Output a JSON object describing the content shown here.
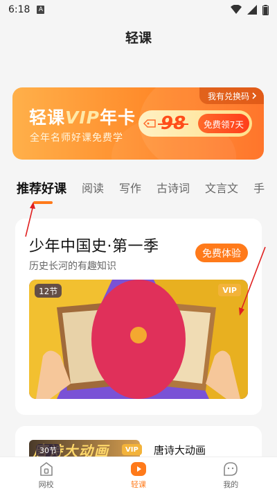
{
  "status_bar": {
    "time": "6:18",
    "notification_glyph": "A"
  },
  "header": {
    "title": "轻课"
  },
  "banner": {
    "title_prefix": "轻课",
    "title_vip": "VIP",
    "title_suffix": "年卡",
    "subtitle": "全年名师好课免费学",
    "redeem_label": "我有兑换码",
    "price": "98",
    "price_button": "免费领7天",
    "colors": {
      "gradient_start": "#ffb04a",
      "gradient_end": "#ff6a1a",
      "price": "#ff4d1a"
    }
  },
  "tabs": [
    "推荐好课",
    "阅读",
    "写作",
    "古诗词",
    "文言文",
    "手"
  ],
  "course_card": {
    "title": "少年中国史·第一季",
    "subtitle": "历史长河的有趣知识",
    "try_button": "免费体验",
    "lessons": "12节",
    "vip_badge": "VIP"
  },
  "course_card_2": {
    "cover_text": "唐诗大动画",
    "lessons": "30节",
    "vip_badge": "VIP",
    "title": "唐诗大动画"
  },
  "bottom_nav": [
    {
      "label": "网校",
      "icon": "school-icon",
      "active": false
    },
    {
      "label": "轻课",
      "icon": "play-icon",
      "active": true
    },
    {
      "label": "我的",
      "icon": "profile-icon",
      "active": false
    }
  ],
  "accent_color": "#ff7a1a",
  "annotation_color": "#e02020"
}
